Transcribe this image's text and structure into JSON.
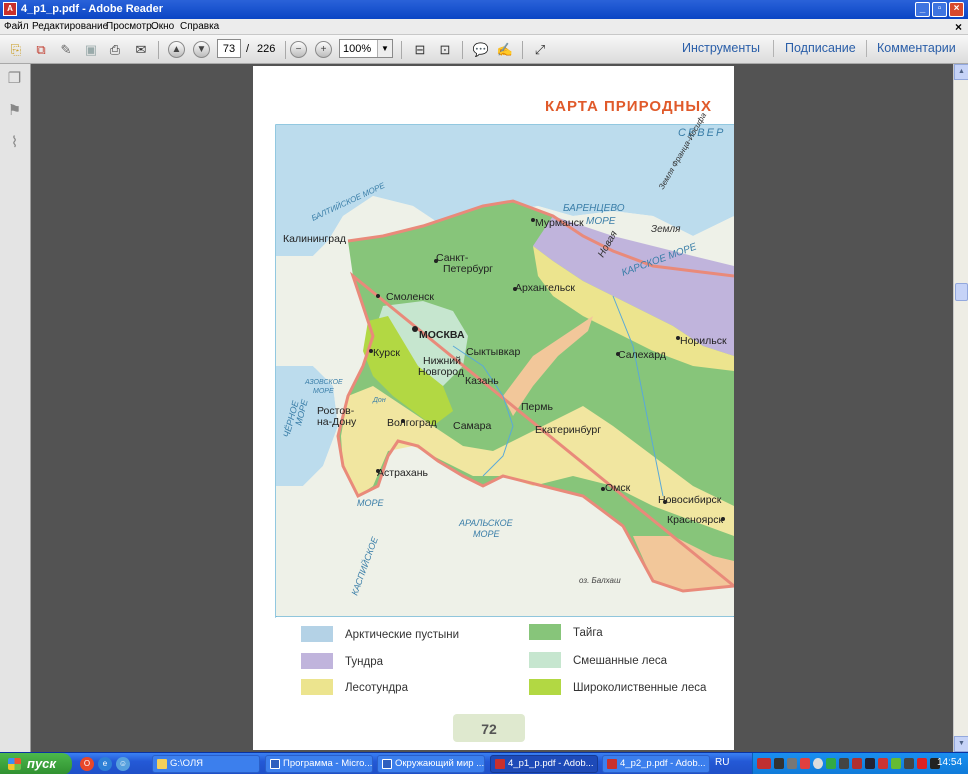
{
  "window": {
    "title": "4_p1_p.pdf - Adobe Reader"
  },
  "menu": {
    "items": [
      "Файл",
      "Редактирование",
      "Просмотр",
      "Окно",
      "Справка"
    ]
  },
  "toolbar": {
    "page_current": "73",
    "page_total": "226",
    "page_separator": "/",
    "zoom": "100%",
    "right_links": [
      "Инструменты",
      "Подписание",
      "Комментарии"
    ]
  },
  "page": {
    "heading": "КАРТА  ПРИРОДНЫХ",
    "page_number": "72",
    "legend": [
      {
        "label": "Арктические пустыни",
        "color": "#b4d2e6"
      },
      {
        "label": "Тайга",
        "color": "#87c57a"
      },
      {
        "label": "Тундра",
        "color": "#c0b4dc"
      },
      {
        "label": "Смешанные  леса",
        "color": "#c6e6cf"
      },
      {
        "label": "Лесотундра",
        "color": "#ece48e"
      },
      {
        "label": "Широколиственные  леса",
        "color": "#b2d843"
      }
    ],
    "map_labels": {
      "sea_north": "СЕВЕР",
      "franz_josef": "Земля Франца-Иосифа",
      "barents_1": "БАРЕНЦЕВО",
      "barents_2": "МОРЕ",
      "novaya_1": "Новая",
      "novaya_2": "Земля",
      "kara": "КАРСКОЕ  МОРЕ",
      "baltic": "БАЛТИЙСКОЕ МОРЕ",
      "kaliningrad": "Калининград",
      "murmansk": "Мурманск",
      "spb_1": "Санкт-",
      "spb_2": "Петербург",
      "arkhangelsk": "Архангельск",
      "smolensk": "Смоленск",
      "moscow": "МОСКВА",
      "norilsk": "Норильск",
      "kursk": "Курск",
      "nn_1": "Нижний",
      "nn_2": "Новгород",
      "syktyvkar": "Сыктывкар",
      "salekhard": "Салехард",
      "azov_1": "АЗОВСКОЕ",
      "azov_2": "МОРЕ",
      "kazan": "Казань",
      "black_1": "ЧЁРНОЕ",
      "black_2": "МОРЕ",
      "rostov_1": "Ростов-",
      "rostov_2": "на-Дону",
      "perm": "Пермь",
      "don": "Дон",
      "volgograd": "Волгоград",
      "samara": "Самара",
      "ekaterinburg": "Екатеринбург",
      "astrakhan": "Астрахань",
      "omsk": "Омск",
      "novosibirsk": "Новосибирск",
      "krasnoyarsk": "Красноярск",
      "aral_1": "АРАЛЬСКОЕ",
      "aral_2": "МОРЕ",
      "caspian_1": "КАСПИЙСКОЕ",
      "caspian_2": "МОРЕ",
      "balkhash": "оз. Балхаш"
    }
  },
  "taskbar": {
    "start_label": "пуск",
    "tasks": [
      {
        "label": "G:\\ОЛЯ",
        "active": false
      },
      {
        "label": "Программа - Micro...",
        "active": false
      },
      {
        "label": "Окружающий мир ...",
        "active": false
      },
      {
        "label": "4_p1_p.pdf - Adob...",
        "active": true
      },
      {
        "label": "4_p2_p.pdf - Adob...",
        "active": false
      }
    ],
    "lang": "RU",
    "clock": "14:54"
  }
}
